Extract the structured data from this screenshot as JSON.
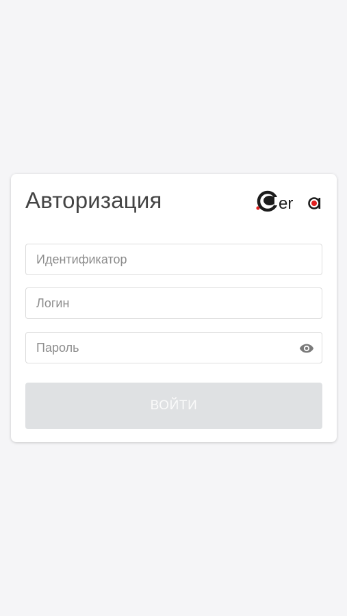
{
  "auth": {
    "title": "Авторизация",
    "logo_text": "Cera",
    "fields": {
      "identifier": {
        "value": "",
        "placeholder": "Идентификатор"
      },
      "login": {
        "value": "",
        "placeholder": "Логин"
      },
      "password": {
        "value": "",
        "placeholder": "Пароль"
      }
    },
    "password_toggle_icon": "eye-icon",
    "submit_label": "ВОЙТИ"
  },
  "colors": {
    "background": "#f5f5f7",
    "card": "#ffffff",
    "title": "#444444",
    "placeholder": "#8d8d8d",
    "button_disabled": "#dfe1e3",
    "logo_accent": "#e02020"
  }
}
